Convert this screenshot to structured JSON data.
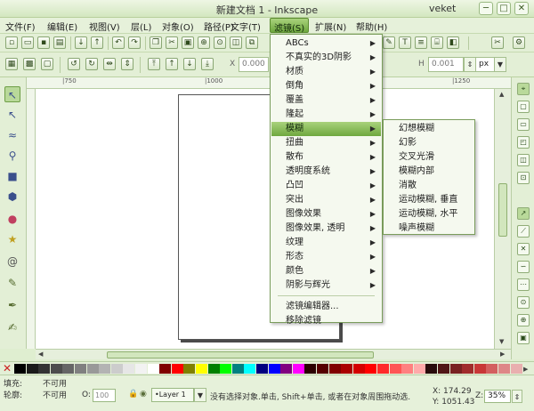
{
  "window": {
    "title": "新建文档 1 - Inkscape",
    "user": "veket",
    "buttons": [
      "─",
      "□",
      "✕"
    ]
  },
  "menubar": {
    "items": [
      "文件(F)",
      "编辑(E)",
      "视图(V)",
      "层(L)",
      "对象(O)",
      "路径(P)",
      "文字(T)",
      "滤镜(S)",
      "扩展(N)",
      "帮助(H)"
    ],
    "active": "滤镜(S)"
  },
  "toolbar2": {
    "x_label": "X",
    "x_value": "0.000",
    "h_label": "H",
    "h_value": "0.001",
    "unit": "px"
  },
  "ruler": {
    "labels": [
      "|750",
      "|1000",
      "|1250"
    ]
  },
  "filters_menu": {
    "items": [
      "ABCs",
      "不真实的3D阴影",
      "材质",
      "倒角",
      "覆盖",
      "隆起",
      "模糊",
      "扭曲",
      "散布",
      "透明度系统",
      "凸凹",
      "突出",
      "图像效果",
      "图像效果, 透明",
      "纹理",
      "形态",
      "颜色",
      "阴影与辉光",
      "滤镜编辑器...",
      "移除滤镜"
    ],
    "highlighted": "模糊"
  },
  "blur_submenu": {
    "items": [
      "幻想模糊",
      "幻影",
      "交叉光滑",
      "模糊内部",
      "消散",
      "运动模糊, 垂直",
      "运动模糊, 水平",
      "噪声模糊"
    ]
  },
  "palette": {
    "colors": [
      "#000000",
      "#1a1a1a",
      "#333333",
      "#4d4d4d",
      "#666666",
      "#808080",
      "#999999",
      "#b3b3b3",
      "#cccccc",
      "#e6e6e6",
      "#f2f2f2",
      "#ffffff",
      "#800000",
      "#ff0000",
      "#808000",
      "#ffff00",
      "#008000",
      "#00ff00",
      "#008080",
      "#00ffff",
      "#000080",
      "#0000ff",
      "#800080",
      "#ff00ff",
      "#2b0000",
      "#550000",
      "#800000",
      "#aa0000",
      "#d40000",
      "#ff0000",
      "#ff2a2a",
      "#ff5555",
      "#ff8080",
      "#ffaaaa",
      "#280b0b",
      "#501616",
      "#782121",
      "#a02c2c",
      "#c83737",
      "#d35f5f",
      "#de8787",
      "#e9afaf"
    ]
  },
  "status": {
    "fill_label": "填充:",
    "fill_value": "不可用",
    "stroke_label": "轮廓:",
    "stroke_value": "不可用",
    "opacity_label": "O:",
    "opacity_value": "100",
    "layer": "•Layer 1",
    "message": "没有选择对象.单击, Shift+单击, 或者在对象周围拖动选.",
    "x_coord": "X:   174.29",
    "y_coord": "Y: 1051.43",
    "zoom_label": "Z:",
    "zoom_value": "35%"
  }
}
